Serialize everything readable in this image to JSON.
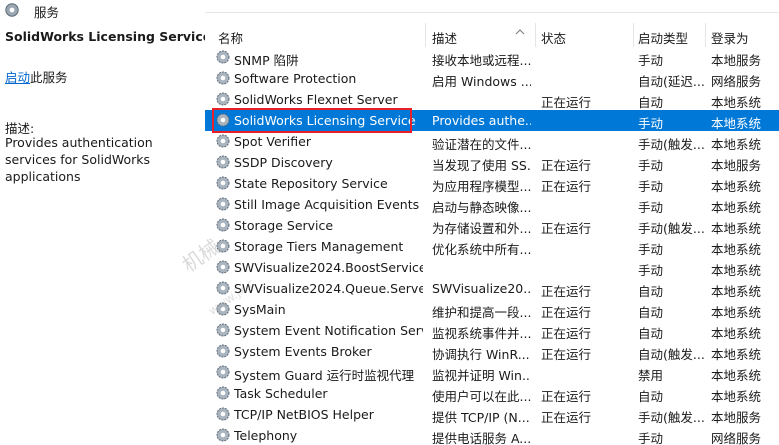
{
  "window": {
    "title": "服务"
  },
  "left_panel": {
    "service_title": "SolidWorks Licensing Service",
    "start_link": "启动",
    "start_suffix": "此服务",
    "desc_label": "描述:",
    "desc_text": "Provides authentication services for SolidWorks applications"
  },
  "columns": {
    "name": "名称",
    "description": "描述",
    "status": "状态",
    "startup": "启动类型",
    "logon": "登录为"
  },
  "rows": [
    {
      "name": "SNMP 陷阱",
      "desc": "接收本地或远程...",
      "status": "",
      "startup": "手动",
      "logon": "本地服务"
    },
    {
      "name": "Software Protection",
      "desc": "启用 Windows ...",
      "status": "",
      "startup": "自动(延迟...",
      "logon": "网络服务"
    },
    {
      "name": "SolidWorks Flexnet Server",
      "desc": "",
      "status": "正在运行",
      "startup": "自动",
      "logon": "本地系统"
    },
    {
      "name": "SolidWorks Licensing Service",
      "desc": "Provides authe...",
      "status": "",
      "startup": "手动",
      "logon": "本地系统",
      "selected": true
    },
    {
      "name": "Spot Verifier",
      "desc": "验证潜在的文件...",
      "status": "",
      "startup": "手动(触发...",
      "logon": "本地系统"
    },
    {
      "name": "SSDP Discovery",
      "desc": "当发现了使用 SS...",
      "status": "正在运行",
      "startup": "手动",
      "logon": "本地服务"
    },
    {
      "name": "State Repository Service",
      "desc": "为应用程序模型...",
      "status": "正在运行",
      "startup": "手动",
      "logon": "本地系统"
    },
    {
      "name": "Still Image Acquisition Events",
      "desc": "启动与静态映像...",
      "status": "",
      "startup": "手动",
      "logon": "本地系统"
    },
    {
      "name": "Storage Service",
      "desc": "为存储设置和外...",
      "status": "正在运行",
      "startup": "手动(触发...",
      "logon": "本地系统"
    },
    {
      "name": "Storage Tiers Management",
      "desc": "优化系统中所有...",
      "status": "",
      "startup": "手动",
      "logon": "本地系统"
    },
    {
      "name": "SWVisualize2024.BoostService",
      "desc": "",
      "status": "",
      "startup": "手动",
      "logon": "本地系统"
    },
    {
      "name": "SWVisualize2024.Queue.Server",
      "desc": "SWVisualize20...",
      "status": "正在运行",
      "startup": "自动",
      "logon": "本地系统"
    },
    {
      "name": "SysMain",
      "desc": "维护和提高一段...",
      "status": "正在运行",
      "startup": "自动",
      "logon": "本地系统"
    },
    {
      "name": "System Event Notification Service",
      "desc": "监视系统事件并...",
      "status": "正在运行",
      "startup": "自动",
      "logon": "本地系统"
    },
    {
      "name": "System Events Broker",
      "desc": "协调执行 WinR...",
      "status": "正在运行",
      "startup": "自动(触发...",
      "logon": "本地系统"
    },
    {
      "name": "System Guard 运行时监视代理",
      "desc": "监视并证明 Win...",
      "status": "",
      "startup": "禁用",
      "logon": "本地系统"
    },
    {
      "name": "Task Scheduler",
      "desc": "使用户可以在此...",
      "status": "正在运行",
      "startup": "自动",
      "logon": "本地系统"
    },
    {
      "name": "TCP/IP NetBIOS Helper",
      "desc": "提供 TCP/IP (N...",
      "status": "正在运行",
      "startup": "手动(触发...",
      "logon": "本地服务"
    },
    {
      "name": "Telephony",
      "desc": "提供电话服务 A...",
      "status": "",
      "startup": "手动",
      "logon": "网络服务"
    }
  ],
  "watermark": {
    "line1": "机械",
    "line2": "www.jx.c"
  },
  "colors": {
    "selection": "#0078d7",
    "highlight_box": "#e8202a",
    "link": "#0066cc"
  },
  "icons": {
    "window": "services-gear-icon",
    "row": "service-gear-icon",
    "sort": "sort-ascending-icon"
  }
}
